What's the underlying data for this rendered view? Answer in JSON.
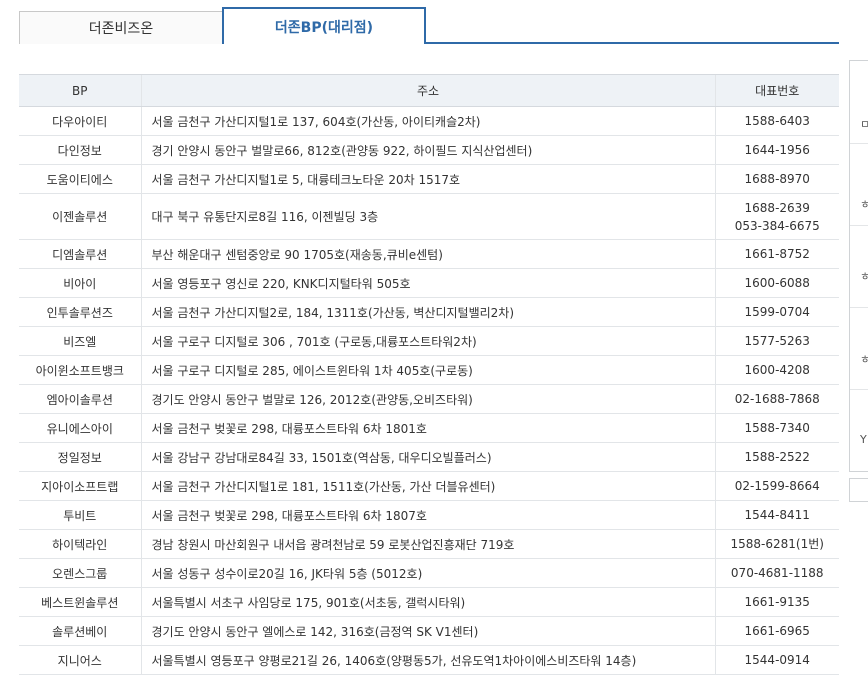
{
  "tabs": [
    {
      "label": "더존비즈온",
      "active": false
    },
    {
      "label": "더존BP(대리점)",
      "active": true
    }
  ],
  "table": {
    "headers": [
      "BP",
      "주소",
      "대표번호"
    ],
    "rows": [
      {
        "name": "다우아이티",
        "address": "서울 금천구 가산디지털1로 137, 604호(가산동, 아이티캐슬2차)",
        "phone": [
          "1588-6403"
        ]
      },
      {
        "name": "다인정보",
        "address": "경기 안양시 동안구 벌말로66, 812호(관양동 922, 하이필드 지식산업센터)",
        "phone": [
          "1644-1956"
        ]
      },
      {
        "name": "도움이티에스",
        "address": "서울 금천구 가산디지털1로 5, 대륭테크노타운 20차 1517호",
        "phone": [
          "1688-8970"
        ]
      },
      {
        "name": "이젠솔루션",
        "address": "대구 북구 유통단지로8길 116, 이젠빌딩 3층",
        "phone": [
          "1688-2639",
          "053-384-6675"
        ]
      },
      {
        "name": "디엠솔루션",
        "address": "부산 해운대구 센텀중앙로 90 1705호(재송동,큐비e센텀)",
        "phone": [
          "1661-8752"
        ]
      },
      {
        "name": "비아이",
        "address": "서울 영등포구 영신로 220, KNK디지털타워 505호",
        "phone": [
          "1600-6088"
        ]
      },
      {
        "name": "인투솔루션즈",
        "address": "서울 금천구 가산디지털2로, 184, 1311호(가산동, 벽산디지털밸리2차)",
        "phone": [
          "1599-0704"
        ]
      },
      {
        "name": "비즈엘",
        "address": "서울 구로구 디지털로 306 , 701호 (구로동,대륭포스트타워2차)",
        "phone": [
          "1577-5263"
        ]
      },
      {
        "name": "아이윈소프트뱅크",
        "address": "서울 구로구 디지털로 285, 에이스트윈타워 1차 405호(구로동)",
        "phone": [
          "1600-4208"
        ]
      },
      {
        "name": "엠아이솔루션",
        "address": "경기도 안양시 동안구 벌말로 126, 2012호(관양동,오비즈타워)",
        "phone": [
          "02-1688-7868"
        ]
      },
      {
        "name": "유니에스아이",
        "address": "서울 금천구 벚꽃로 298, 대륭포스트타워 6차 1801호",
        "phone": [
          "1588-7340"
        ]
      },
      {
        "name": "정일정보",
        "address": "서울 강남구 강남대로84길 33, 1501호(역삼동, 대우디오빌플러스)",
        "phone": [
          "1588-2522"
        ]
      },
      {
        "name": "지아이소프트랩",
        "address": "서울 금천구 가산디지털1로 181, 1511호(가산동, 가산 더블유센터)",
        "phone": [
          "02-1599-8664"
        ]
      },
      {
        "name": "투비트",
        "address": "서울 금천구 벚꽃로 298, 대륭포스트타워 6차 1807호",
        "phone": [
          "1544-8411"
        ]
      },
      {
        "name": "하이텍라인",
        "address": "경남 창원시 마산회원구 내서읍 광려천남로 59 로봇산업진흥재단 719호",
        "phone": [
          "1588-6281(1번)"
        ]
      },
      {
        "name": "오렌스그룹",
        "address": "서울 성동구 성수이로20길 16, JK타워 5층 (5012호)",
        "phone": [
          "070-4681-1188"
        ]
      },
      {
        "name": "베스트윈솔루션",
        "address": "서울특별시 서초구 사임당로 175, 901호(서초동, 갤럭시타워)",
        "phone": [
          "1661-9135"
        ]
      },
      {
        "name": "솔루션베이",
        "address": "경기도 안양시 동안구 엘에스로 142, 316호(금정역 SK V1센터)",
        "phone": [
          "1661-6965"
        ]
      },
      {
        "name": "지니어스",
        "address": "서울특별시 영등포구 양평로21길 26, 1406호(양평동5가, 선유도역1차아이에스비즈타워 14층)",
        "phone": [
          "1544-0914"
        ]
      }
    ]
  },
  "side_panel": {
    "glyphs": [
      "ㅁ",
      "ㅎ",
      "ㅎ",
      "ㅎ",
      "Y"
    ]
  }
}
